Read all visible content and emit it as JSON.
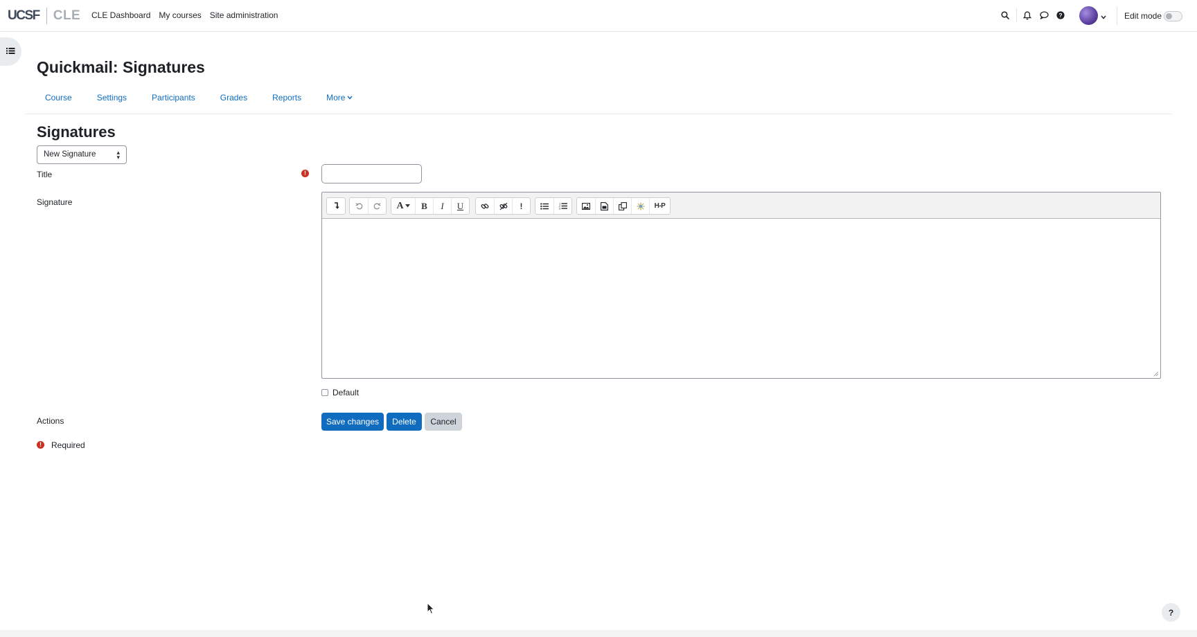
{
  "navbar": {
    "logo_ucsf": "UCSF",
    "logo_cle": "CLE",
    "links": [
      "CLE Dashboard",
      "My courses",
      "Site administration"
    ],
    "icons": [
      "search-icon",
      "bell-icon",
      "chat-icon",
      "help-icon"
    ],
    "edit_mode_label": "Edit mode"
  },
  "page": {
    "title": "Quickmail: Signatures",
    "secondary_nav": [
      "Course",
      "Settings",
      "Participants",
      "Grades",
      "Reports",
      "More"
    ]
  },
  "form": {
    "section_title": "Signatures",
    "signature_select": "New Signature",
    "title_label": "Title",
    "title_value": "",
    "signature_label": "Signature",
    "default_label": "Default",
    "default_checked": false,
    "actions_label": "Actions",
    "save_label": "Save changes",
    "delete_label": "Delete",
    "cancel_label": "Cancel",
    "required_label": "Required"
  },
  "editor": {
    "toolbar_icons": [
      "collapse-icon",
      "undo-icon",
      "redo-icon",
      "font-color-icon",
      "bold-icon",
      "italic-icon",
      "underline-icon",
      "link-icon",
      "unlink-icon",
      "emoticon-icon",
      "bullet-list-icon",
      "numbered-list-icon",
      "image-icon",
      "media-icon",
      "manage-files-icon",
      "accessibility-icon",
      "h5p-icon"
    ],
    "content": ""
  },
  "colors": {
    "primary": "#0f6cbf",
    "required": "#ca3120"
  },
  "help_button": "?"
}
